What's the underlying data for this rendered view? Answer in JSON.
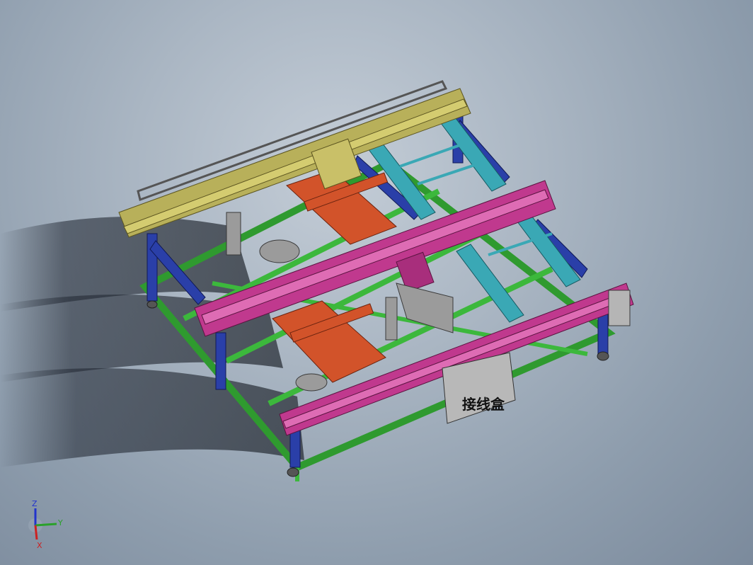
{
  "viewport": {
    "background_top": "#c4cdd7",
    "background_bottom": "#7b8a9c"
  },
  "model": {
    "junction_box_label": "接线盒",
    "colors": {
      "yellow_rail": "#b8b05a",
      "magenta_rail": "#c0398e",
      "cyan_rail": "#3aa8b5",
      "blue_frame": "#2a3fa8",
      "green_base": "#3cb83c",
      "orange_plates": "#d2532a",
      "gray_parts": "#8c8c8c"
    }
  },
  "triad": {
    "z_label": "Z",
    "y_label": "Y",
    "x_label": "X",
    "z_color": "#2233cc",
    "y_color": "#2aa12a",
    "x_color": "#cc2222"
  }
}
